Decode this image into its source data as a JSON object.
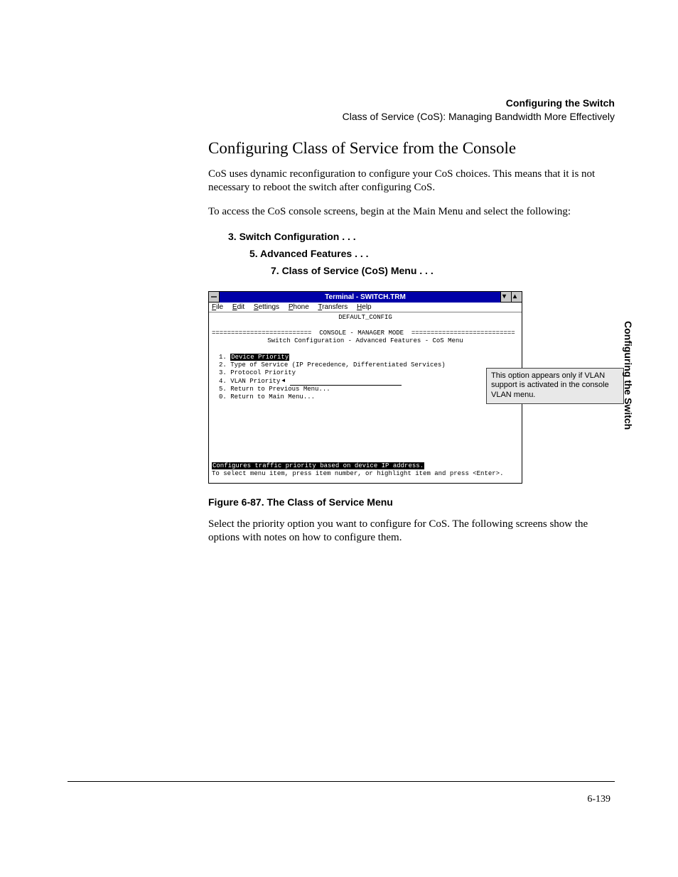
{
  "header": {
    "title": "Configuring the Switch",
    "subtitle": "Class of Service (CoS): Managing Bandwidth More Effectively"
  },
  "section_heading": "Configuring Class of Service from the Console",
  "para1": "CoS uses dynamic reconfiguration to configure your CoS choices. This means that it is not necessary to reboot the switch after configuring CoS.",
  "para2": "To access the CoS console screens, begin at the Main Menu and select the following:",
  "menu_path": {
    "l1": "3. Switch Configuration . . .",
    "l2": "5. Advanced Features . . .",
    "l3": "7. Class of Service (CoS) Menu . . ."
  },
  "terminal": {
    "title": "Terminal - SWITCH.TRM",
    "menus": [
      "File",
      "Edit",
      "Settings",
      "Phone",
      "Transfers",
      "Help"
    ],
    "default_config": "DEFAULT_CONFIG",
    "console_banner": "==========================  CONSOLE - MANAGER MODE  ===========================",
    "breadcrumb": "Switch Configuration - Advanced Features - CoS Menu",
    "items": [
      {
        "n": "1.",
        "label": "Device Priority",
        "highlighted": true
      },
      {
        "n": "2.",
        "label": "Type of Service (IP Precedence, Differentiated Services)"
      },
      {
        "n": "3.",
        "label": "Protocol Priority"
      },
      {
        "n": "4.",
        "label": "VLAN Priority",
        "arrow": true
      },
      {
        "n": "5.",
        "label": "Return to Previous Menu..."
      },
      {
        "n": "0.",
        "label": "Return to Main Menu..."
      }
    ],
    "status1": "Configures traffic priority based on device IP address.",
    "status2": "To select menu item, press item number, or highlight item and press <Enter>."
  },
  "callout": "This option appears only if VLAN support is activated in the console VLAN menu.",
  "figure_caption": "Figure 6-87.  The Class of Service Menu",
  "para3": "Select the priority option you want to configure for CoS. The following screens show the options with notes on how to configure them.",
  "side_tab": "Configuring the Switch",
  "page_number": "6-139"
}
